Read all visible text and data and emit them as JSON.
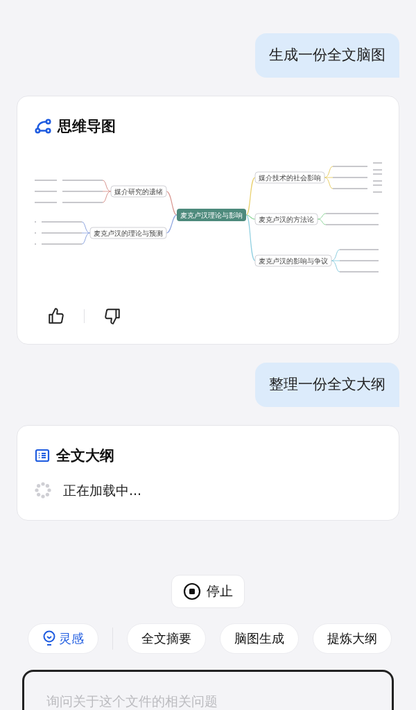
{
  "messages": [
    {
      "kind": "user",
      "text": "生成一份全文脑图"
    },
    {
      "kind": "mindmap",
      "title": "思维导图",
      "root": "麦克卢汉理论与影响",
      "left_branches": [
        {
          "label": "媒介研究的遗绪"
        },
        {
          "label": "麦克卢汉的理论与预测"
        }
      ],
      "right_branches": [
        {
          "label": "媒介技术的社会影响"
        },
        {
          "label": "麦克卢汉的方法论"
        },
        {
          "label": "麦克卢汉的影响与争议"
        }
      ]
    },
    {
      "kind": "user",
      "text": "整理一份全文大纲"
    },
    {
      "kind": "outline",
      "title": "全文大纲",
      "status": "正在加载中..."
    }
  ],
  "stop_button": "停止",
  "chips": [
    {
      "label": "灵感",
      "kind": "accent"
    },
    {
      "label": "全文摘要",
      "kind": "plain"
    },
    {
      "label": "脑图生成",
      "kind": "plain"
    },
    {
      "label": "提炼大纲",
      "kind": "plain"
    }
  ],
  "input": {
    "placeholder": "询问关于这个文件的相关问题"
  }
}
